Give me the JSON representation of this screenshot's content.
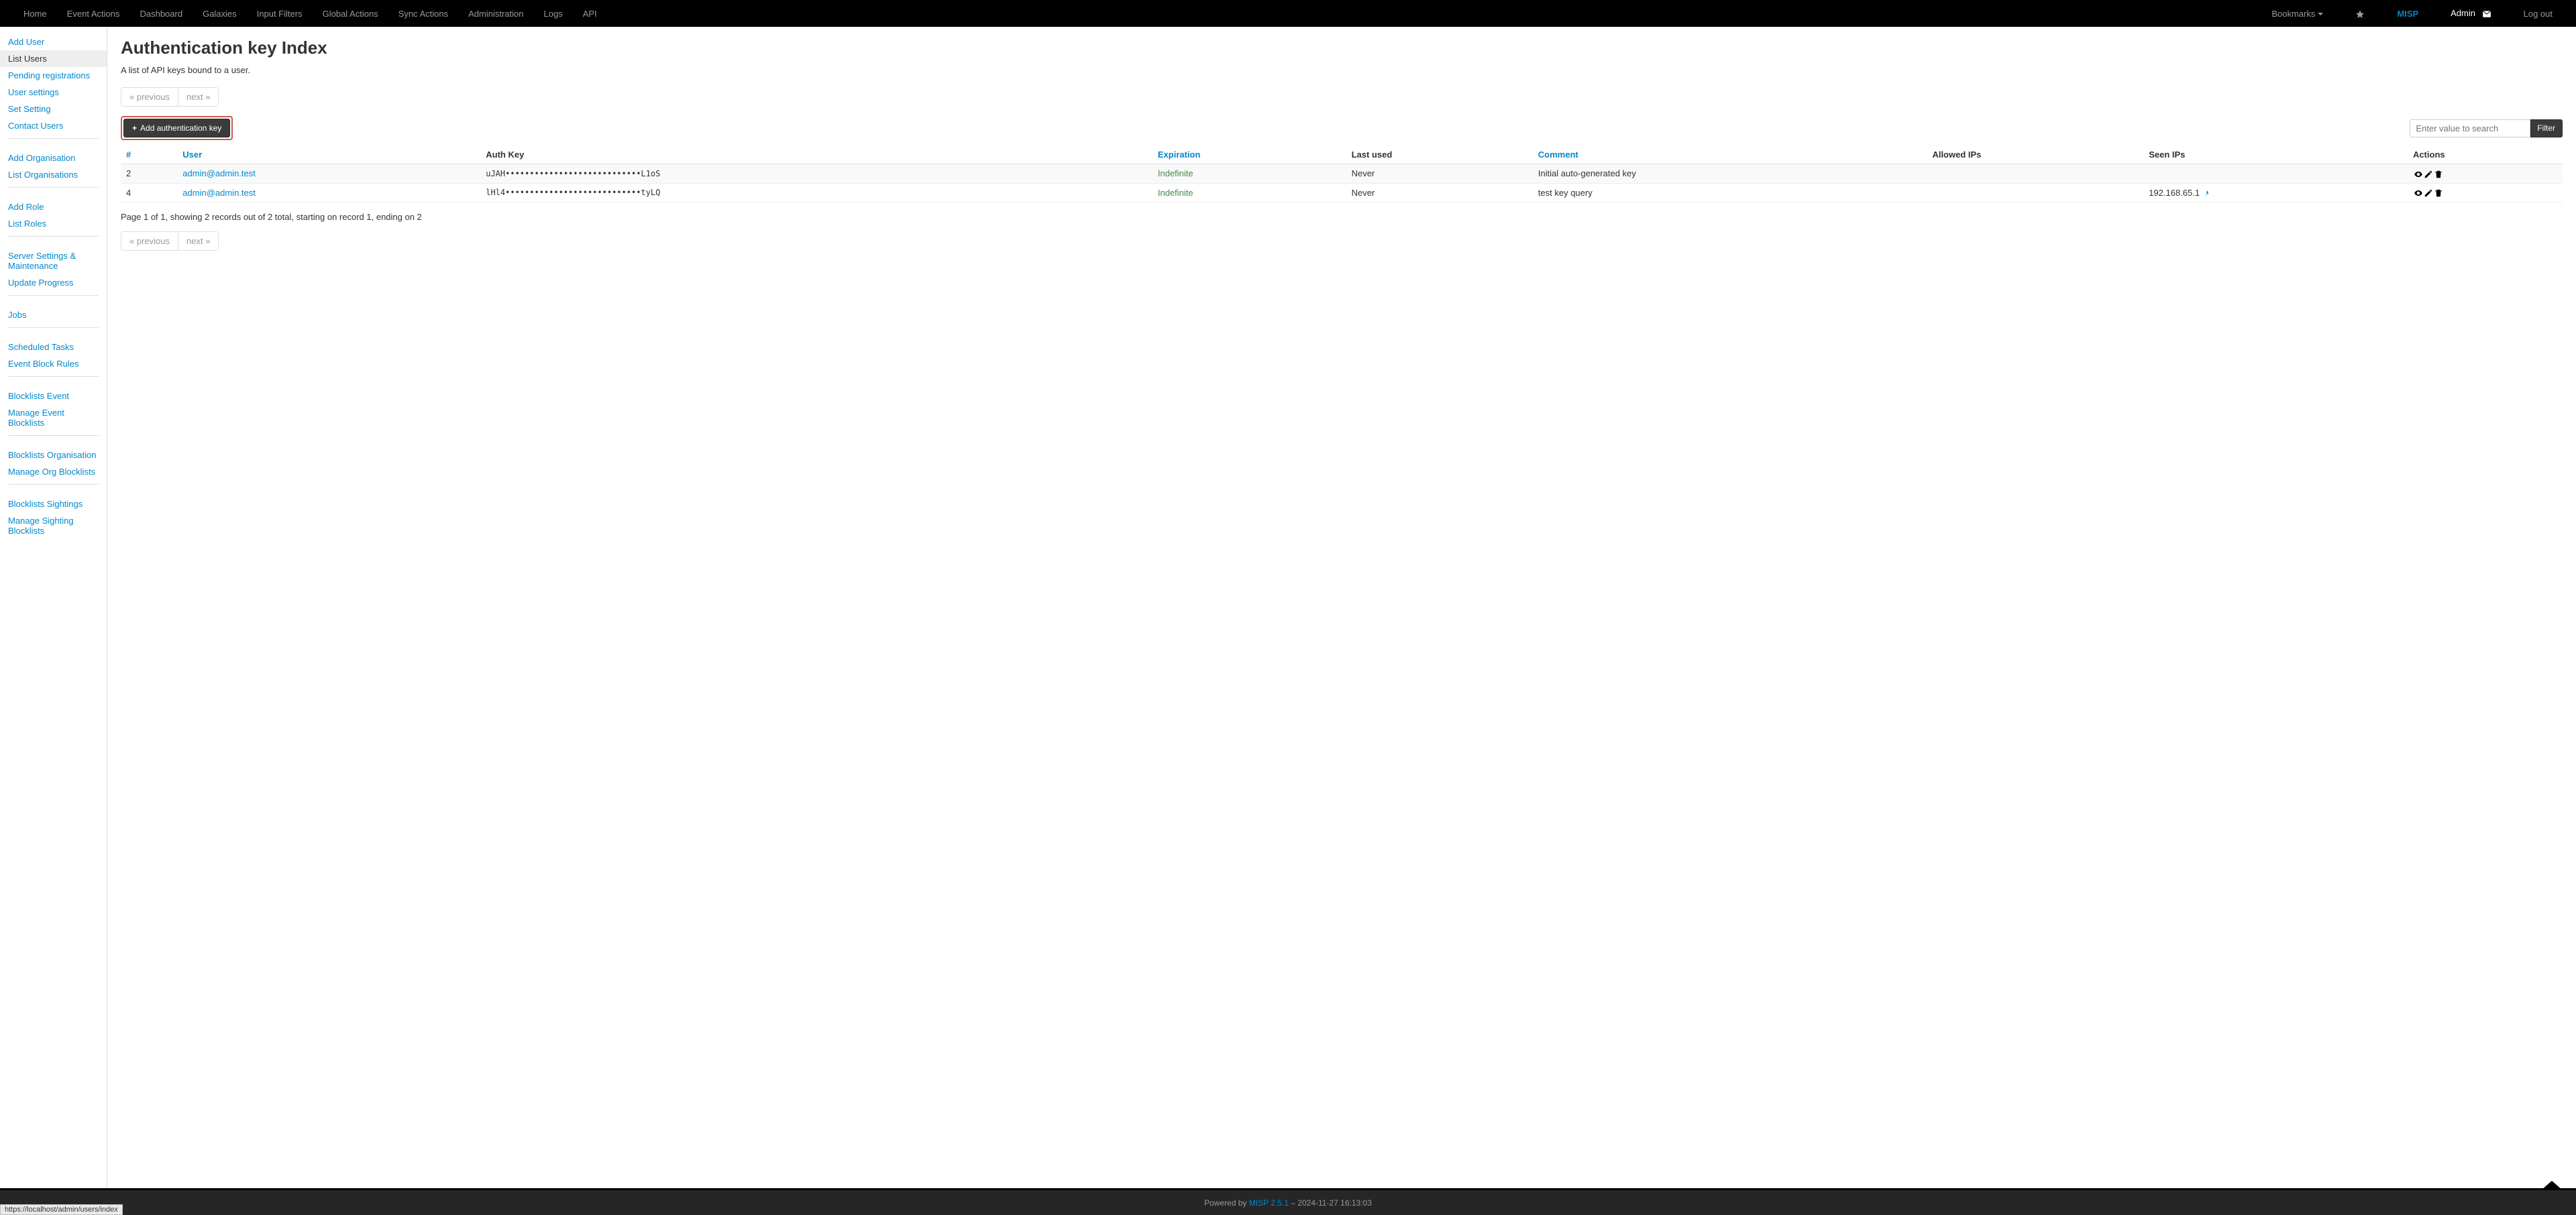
{
  "topnav": {
    "left": [
      "Home",
      "Event Actions",
      "Dashboard",
      "Galaxies",
      "Input Filters",
      "Global Actions",
      "Sync Actions",
      "Administration",
      "Logs",
      "API"
    ],
    "bookmarks": "Bookmarks",
    "brand": "MISP",
    "admin": "Admin",
    "logout": "Log out"
  },
  "sidebar": {
    "groups": [
      {
        "items": [
          {
            "label": "Add User"
          },
          {
            "label": "List Users",
            "active": true
          },
          {
            "label": "Pending registrations"
          },
          {
            "label": "User settings"
          },
          {
            "label": "Set Setting"
          },
          {
            "label": "Contact Users"
          }
        ]
      },
      {
        "items": [
          {
            "label": "Add Organisation"
          },
          {
            "label": "List Organisations"
          }
        ]
      },
      {
        "items": [
          {
            "label": "Add Role"
          },
          {
            "label": "List Roles"
          }
        ]
      },
      {
        "items": [
          {
            "label": "Server Settings & Maintenance"
          },
          {
            "label": "Update Progress"
          }
        ]
      },
      {
        "items": [
          {
            "label": "Jobs"
          }
        ]
      },
      {
        "items": [
          {
            "label": "Scheduled Tasks"
          },
          {
            "label": "Event Block Rules"
          }
        ]
      },
      {
        "items": [
          {
            "label": "Blocklists Event"
          },
          {
            "label": "Manage Event Blocklists"
          }
        ]
      },
      {
        "items": [
          {
            "label": "Blocklists Organisation"
          },
          {
            "label": "Manage Org Blocklists"
          }
        ]
      },
      {
        "items": [
          {
            "label": "Blocklists Sightings"
          },
          {
            "label": "Manage Sighting Blocklists"
          }
        ]
      }
    ]
  },
  "page": {
    "title": "Authentication key Index",
    "desc": "A list of API keys bound to a user.",
    "prev": "« previous",
    "next": "next »",
    "add_btn": "Add authentication key",
    "search_placeholder": "Enter value to search",
    "filter_btn": "Filter",
    "record_info": "Page 1 of 1, showing 2 records out of 2 total, starting on record 1, ending on 2"
  },
  "table": {
    "headers": {
      "id": "#",
      "user": "User",
      "auth_key": "Auth Key",
      "expiration": "Expiration",
      "last_used": "Last used",
      "comment": "Comment",
      "allowed_ips": "Allowed IPs",
      "seen_ips": "Seen IPs",
      "actions": "Actions"
    },
    "rows": [
      {
        "id": "2",
        "user": "admin@admin.test",
        "auth_key": "uJAH••••••••••••••••••••••••••••L1oS",
        "expiration": "Indefinite",
        "last_used": "Never",
        "comment": "Initial auto-generated key",
        "allowed_ips": "",
        "seen_ips": "",
        "pinned": false
      },
      {
        "id": "4",
        "user": "admin@admin.test",
        "auth_key": "lHl4••••••••••••••••••••••••••••tyLQ",
        "expiration": "Indefinite",
        "last_used": "Never",
        "comment": "test key query",
        "allowed_ips": "",
        "seen_ips": "192.168.65.1",
        "pinned": true
      }
    ]
  },
  "footer": {
    "powered": "Powered by ",
    "misp_link": "MISP 2.5.1",
    "timestamp": " – 2024-11-27 16:13:03"
  },
  "status_url": "https://localhost/admin/users/index"
}
